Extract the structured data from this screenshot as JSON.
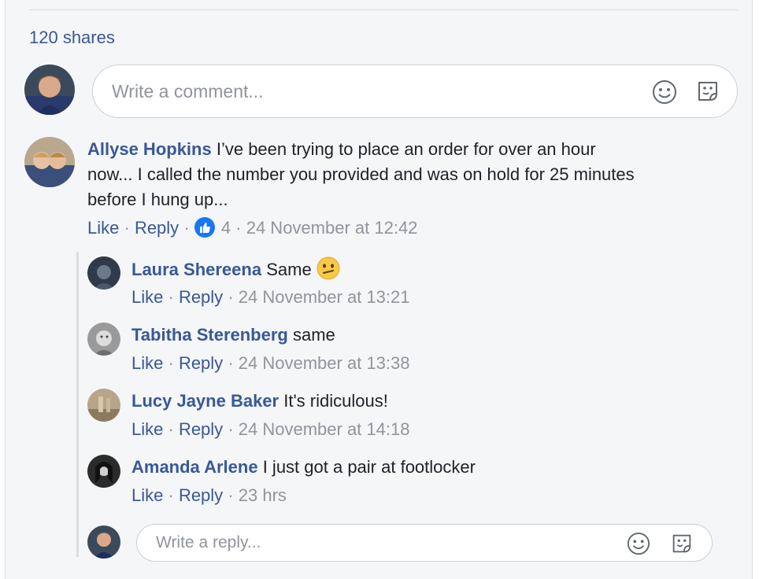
{
  "shares": "120 shares",
  "composer": {
    "placeholder": "Write a comment...",
    "emoji_icon": "smiley-icon",
    "sticker_icon": "sticker-icon"
  },
  "top_comment": {
    "author": "Allyse Hopkins",
    "line1": "I’ve been trying to place an order for over an hour",
    "line2": "now... I called the number you provided and was on hold for 25 minutes",
    "line3": "before I hung up...",
    "like_label": "Like",
    "reply_label": "Reply",
    "reaction_icon": "thumbs-up-icon",
    "reaction_count": "4",
    "timestamp": "24 November at 12:42"
  },
  "replies": [
    {
      "author": "Laura Shereena",
      "text": "Same",
      "emoji": "confused-face-emoji",
      "like_label": "Like",
      "reply_label": "Reply",
      "timestamp": "24 November at 13:21"
    },
    {
      "author": "Tabitha Sterenberg",
      "text": "same",
      "like_label": "Like",
      "reply_label": "Reply",
      "timestamp": "24 November at 13:38"
    },
    {
      "author": "Lucy Jayne Baker",
      "text": "It's ridiculous!",
      "like_label": "Like",
      "reply_label": "Reply",
      "timestamp": "24 November at 14:18"
    },
    {
      "author": "Amanda Arlene",
      "text": "I just got a pair at footlocker",
      "like_label": "Like",
      "reply_label": "Reply",
      "timestamp": "23 hrs"
    }
  ],
  "reply_composer": {
    "placeholder": "Write a reply..."
  },
  "separator": "·",
  "colors": {
    "link": "#385898",
    "muted": "#90949c",
    "like_blue": "#1877f2",
    "panel_bg": "#f5f6f7"
  }
}
